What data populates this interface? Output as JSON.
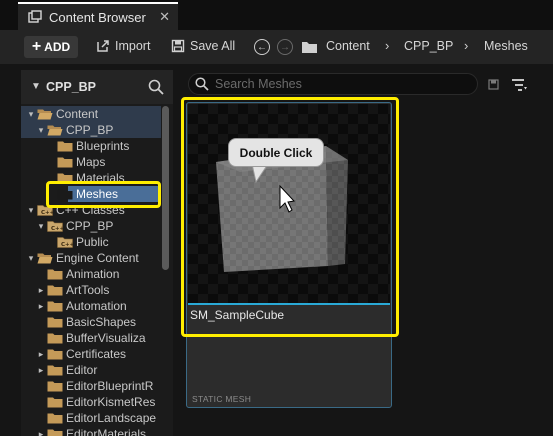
{
  "tab": {
    "title": "Content Browser",
    "close": "✕"
  },
  "toolbar": {
    "add_label": "ADD",
    "import_label": "Import",
    "save_all_label": "Save All",
    "breadcrumbs": [
      "Content",
      "CPP_BP",
      "Meshes"
    ]
  },
  "sidebar": {
    "header_title": "CPP_BP",
    "tree": [
      {
        "label": "Content",
        "level": 0,
        "expanded": true,
        "icon": "folder-open-icon"
      },
      {
        "label": "CPP_BP",
        "level": 1,
        "expanded": true,
        "icon": "folder-open-icon"
      },
      {
        "label": "Blueprints",
        "level": 2,
        "icon": "folder-icon"
      },
      {
        "label": "Maps",
        "level": 2,
        "icon": "folder-icon"
      },
      {
        "label": "Materials",
        "level": 2,
        "icon": "folder-icon"
      },
      {
        "label": "Meshes",
        "level": 2,
        "selected": true,
        "icon": "folder-icon"
      },
      {
        "label": "C++ Classes",
        "level": 0,
        "expanded": true,
        "icon": "cpp-folder-icon"
      },
      {
        "label": "CPP_BP",
        "level": 1,
        "expanded": true,
        "icon": "cpp-folder-icon"
      },
      {
        "label": "Public",
        "level": 2,
        "icon": "cpp-folder-icon"
      },
      {
        "label": "Engine Content",
        "level": 0,
        "expanded": true,
        "icon": "folder-open-icon"
      },
      {
        "label": "Animation",
        "level": 1,
        "icon": "folder-icon"
      },
      {
        "label": "ArtTools",
        "level": 1,
        "collapsed": true,
        "icon": "folder-icon"
      },
      {
        "label": "Automation",
        "level": 1,
        "collapsed": true,
        "icon": "folder-icon"
      },
      {
        "label": "BasicShapes",
        "level": 1,
        "icon": "folder-icon"
      },
      {
        "label": "BufferVisualiza",
        "level": 1,
        "icon": "folder-icon"
      },
      {
        "label": "Certificates",
        "level": 1,
        "collapsed": true,
        "icon": "folder-icon"
      },
      {
        "label": "Editor",
        "level": 1,
        "collapsed": true,
        "icon": "folder-icon"
      },
      {
        "label": "EditorBlueprintR",
        "level": 1,
        "icon": "folder-icon"
      },
      {
        "label": "EditorKismetRes",
        "level": 1,
        "icon": "folder-icon"
      },
      {
        "label": "EditorLandscape",
        "level": 1,
        "icon": "folder-icon"
      },
      {
        "label": "EditorMaterials",
        "level": 1,
        "collapsed": true,
        "icon": "folder-icon"
      }
    ]
  },
  "search": {
    "placeholder": "Search Meshes"
  },
  "asset": {
    "name": "SM_SampleCube",
    "type": "STATIC MESH"
  },
  "tooltip": {
    "text": "Double Click"
  },
  "colors": {
    "highlight": "#ffee00",
    "selection": "#4a6e98",
    "accent": "#2aa9d6"
  }
}
